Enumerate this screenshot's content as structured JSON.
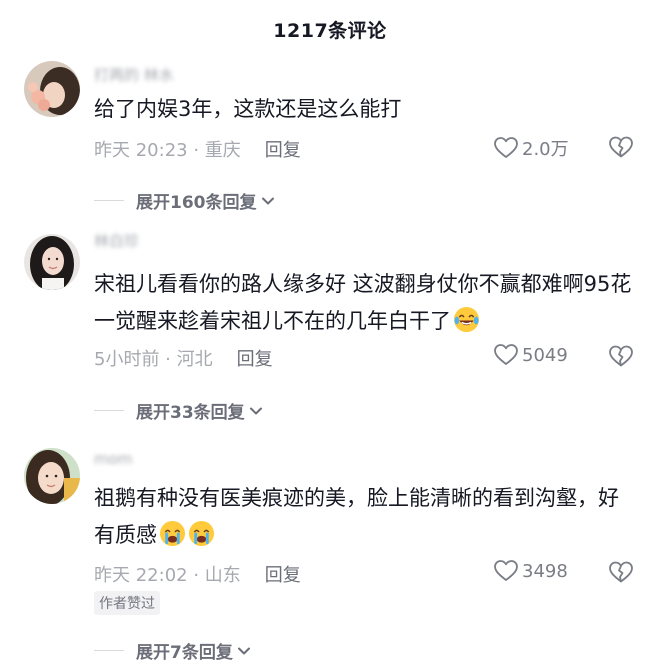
{
  "header": {
    "title": "1217条评论"
  },
  "comments": [
    {
      "username": "打两的 林水",
      "text": "给了内娱3年，这款还是这么能打",
      "time_location": "昨天 20:23 · 重庆",
      "reply_label": "回复",
      "likes": "2.0万",
      "expand_label": "展开160条回复"
    },
    {
      "username": "林白珍",
      "text": "宋祖儿看看你的路人缘多好 这波翻身仗你不赢都难啊95花一觉醒来趁着宋祖儿不在的几年白干了",
      "time_location": "5小时前 · 河北",
      "reply_label": "回复",
      "likes": "5049",
      "expand_label": "展开33条回复"
    },
    {
      "username": "mom",
      "text": "祖鹅有种没有医美痕迹的美，脸上能清晰的看到沟壑，好有质感",
      "time_location": "昨天 22:02 · 山东",
      "reply_label": "回复",
      "likes": "3498",
      "author_badge": "作者赞过",
      "expand_label": "展开7条回复"
    }
  ],
  "icons": {
    "like": "heart-outline-icon",
    "dislike": "broken-heart-icon",
    "expand": "chevron-down-icon",
    "emoji_laugh": "laugh-cry-emoji",
    "emoji_cry": "crying-emoji"
  }
}
